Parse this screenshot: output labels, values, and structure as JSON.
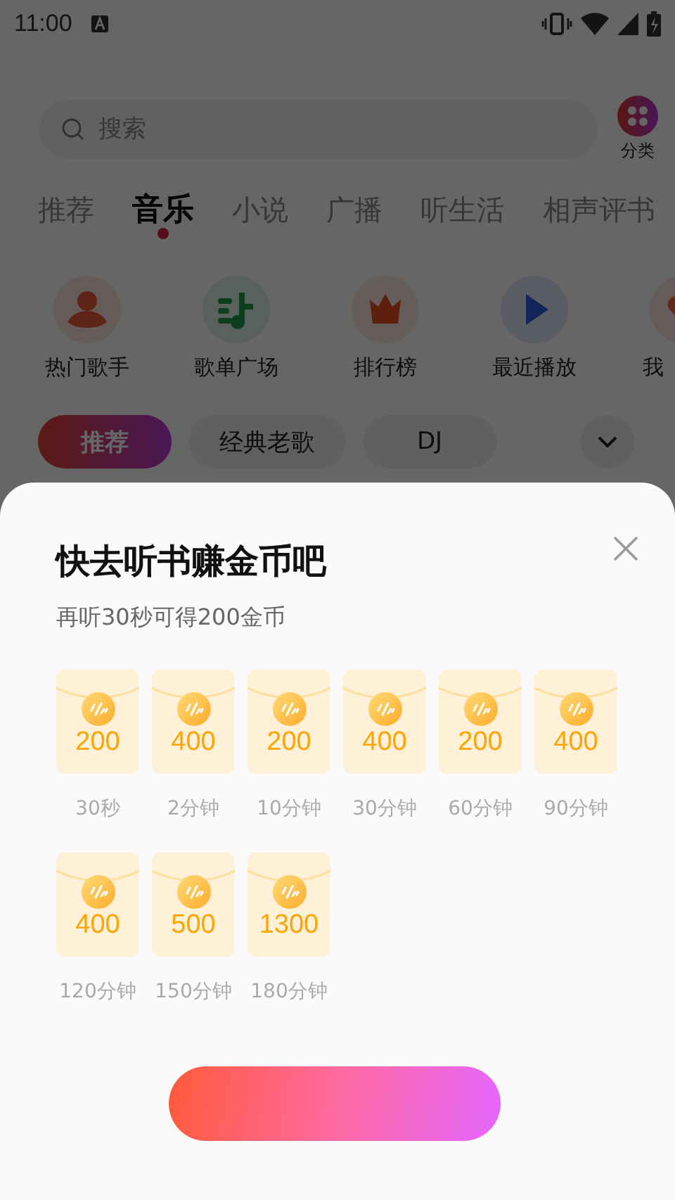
{
  "status_bar": {
    "time": "11:00"
  },
  "search": {
    "placeholder": "搜索"
  },
  "category": {
    "label": "分类"
  },
  "tabs": [
    {
      "label": "推荐",
      "selected": false
    },
    {
      "label": "音乐",
      "selected": true
    },
    {
      "label": "小说",
      "selected": false
    },
    {
      "label": "广播",
      "selected": false
    },
    {
      "label": "听生活",
      "selected": false
    },
    {
      "label": "相声评书",
      "selected": false
    }
  ],
  "shortcuts": [
    {
      "label": "热门歌手",
      "kind": "singer"
    },
    {
      "label": "歌单广场",
      "kind": "playlist"
    },
    {
      "label": "排行榜",
      "kind": "chart"
    },
    {
      "label": "最近播放",
      "kind": "recent"
    },
    {
      "label": "我",
      "kind": "mine"
    }
  ],
  "chips": [
    {
      "label": "推荐",
      "selected": true
    },
    {
      "label": "经典老歌",
      "selected": false
    },
    {
      "label": "DJ",
      "selected": false
    }
  ],
  "sheet": {
    "title": "快去听书赚金币吧",
    "subtitle": "再听30秒可得200金币",
    "rewards": [
      {
        "coins": "200",
        "time": "30秒"
      },
      {
        "coins": "400",
        "time": "2分钟"
      },
      {
        "coins": "200",
        "time": "10分钟"
      },
      {
        "coins": "400",
        "time": "30分钟"
      },
      {
        "coins": "200",
        "time": "60分钟"
      },
      {
        "coins": "400",
        "time": "90分钟"
      },
      {
        "coins": "400",
        "time": "120分钟"
      },
      {
        "coins": "500",
        "time": "150分钟"
      },
      {
        "coins": "1300",
        "time": "180分钟"
      }
    ]
  }
}
